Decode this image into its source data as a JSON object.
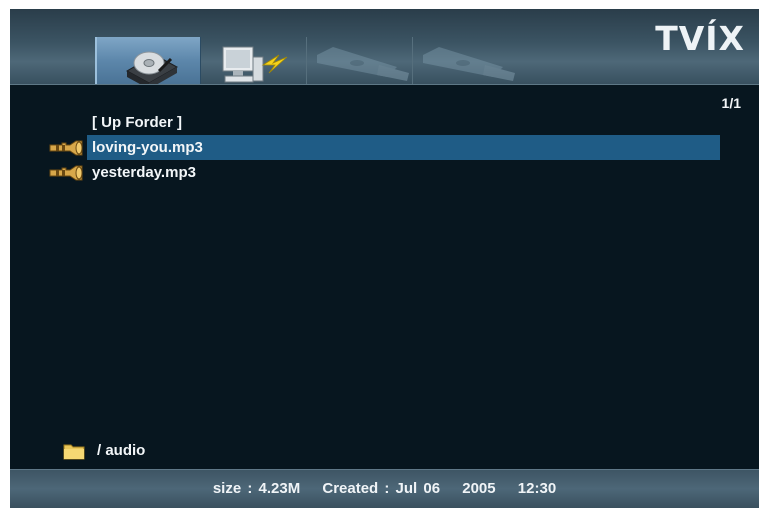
{
  "header": {
    "logo": "TVÍX",
    "tabs": [
      {
        "name": "hard-disk",
        "icon": "hdd-icon",
        "selected": true
      },
      {
        "name": "network",
        "icon": "network-pc-icon",
        "selected": false
      },
      {
        "name": "usb-1",
        "icon": "usb-icon",
        "selected": false
      },
      {
        "name": "usb-2",
        "icon": "usb-icon",
        "selected": false
      }
    ]
  },
  "browser": {
    "page_indicator": "1/1",
    "items": [
      {
        "label": "[ Up Forder ]",
        "icon": "",
        "selected": false
      },
      {
        "label": "loving-you.mp3",
        "icon": "trumpet-music-icon",
        "selected": true
      },
      {
        "label": "yesterday.mp3",
        "icon": "trumpet-music-icon",
        "selected": false
      }
    ],
    "current_path": "/ audio"
  },
  "status": {
    "size": "size : 4.23M",
    "created": "Created : Jul 06",
    "year": "2005",
    "time": "12:30"
  },
  "colors": {
    "background": "#07161f",
    "header": "#3b5463",
    "selected_row": "#1f5c86",
    "selected_tab": "#5d87ab"
  }
}
